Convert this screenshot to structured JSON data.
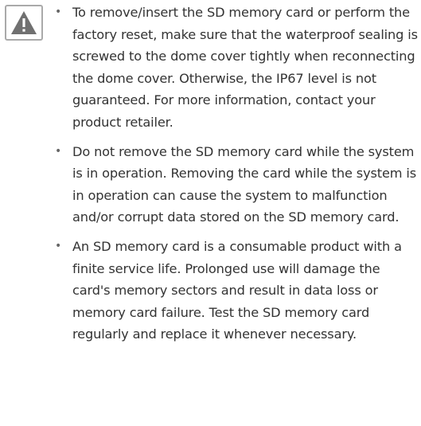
{
  "caution_icon": "warning-triangle-icon",
  "colors": {
    "text": "#333333",
    "icon_fill": "#707070",
    "icon_border": "#aaaaaa"
  },
  "notes": [
    {
      "bullet": "•",
      "text": "To remove/insert the SD memory card or perform the factory reset, make sure that the waterproof sealing is screwed to the dome cover tightly when reconnecting the dome cover. Otherwise, the IP67 level is not guaranteed. For more information, contact your product retailer."
    },
    {
      "bullet": "•",
      "text": "Do not remove the SD memory card while the system is in operation. Removing the card while the system is in operation can cause the system to malfunction and/or corrupt data stored on the SD memory card."
    },
    {
      "bullet": "•",
      "text": "An SD memory card is a consumable product with a finite service life. Prolonged use will damage the card's memory sectors and result in data loss or memory card failure. Test the SD memory card regularly and replace it whenever necessary."
    }
  ]
}
